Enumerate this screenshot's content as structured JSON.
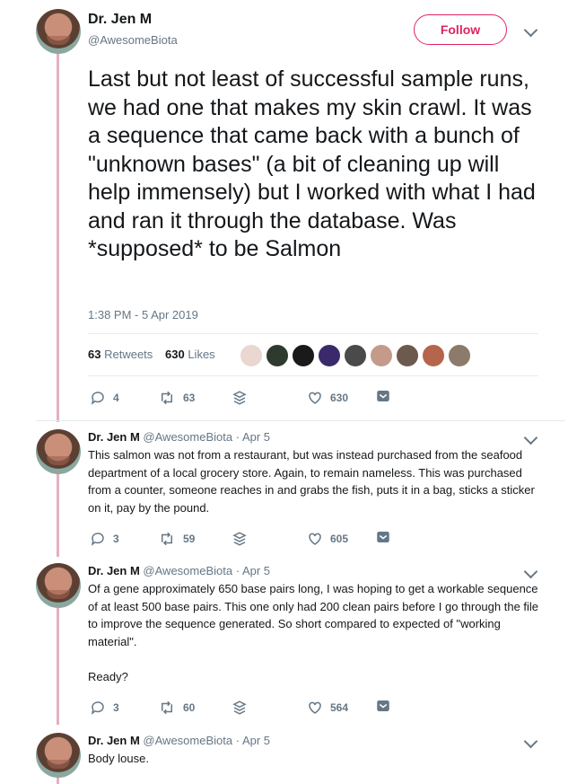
{
  "main_tweet": {
    "author_name": "Dr. Jen M",
    "handle": "@AwesomeBiota",
    "follow_label": "Follow",
    "text": "Last but not least of successful sample runs, we had one that makes my skin crawl. It was a sequence that came back with a bunch of \"unknown bases\" (a bit of cleaning up will help immensely) but I worked with what I had and ran it through the database. Was *supposed* to be Salmon",
    "timestamp": "1:38 PM - 5 Apr 2019",
    "retweets_count": "63",
    "retweets_label": "Retweets",
    "likes_count": "630",
    "likes_label": "Likes",
    "actions": {
      "replies": "4",
      "retweets": "63",
      "likes": "630"
    }
  },
  "likers": [
    "#e9d7d0",
    "#2f3a2f",
    "#1a1a1a",
    "#3b2a6b",
    "#4a4a4a",
    "#c49a8a",
    "#6d5a4e",
    "#b5654c",
    "#8c7a6a"
  ],
  "replies": [
    {
      "author_name": "Dr. Jen M",
      "handle": "@AwesomeBiota",
      "date": "· Apr 5",
      "text": "This salmon was not from a restaurant, but was instead purchased from the seafood department of a local grocery store. Again, to remain nameless. This was purchased from a counter, someone reaches in and grabs the fish, puts it in a bag, sticks a sticker on it, pay by the pound.",
      "replies": "3",
      "retweets": "59",
      "likes": "605"
    },
    {
      "author_name": "Dr. Jen M",
      "handle": "@AwesomeBiota",
      "date": "· Apr 5",
      "text": "Of a gene approximately 650 base pairs long, I was hoping to get a workable sequence of at least 500 base pairs. This one only had 200 clean pairs before I go through the file to improve the sequence generated. So short compared to expected of \"working material\".\n\nReady?",
      "replies": "3",
      "retweets": "60",
      "likes": "564"
    },
    {
      "author_name": "Dr. Jen M",
      "handle": "@AwesomeBiota",
      "date": "· Apr 5",
      "text": "Body louse."
    }
  ],
  "colors": {
    "accent": "#e0245e",
    "muted": "#657786",
    "thread_line": "#e3b0bd",
    "message_icon": "#657786"
  }
}
